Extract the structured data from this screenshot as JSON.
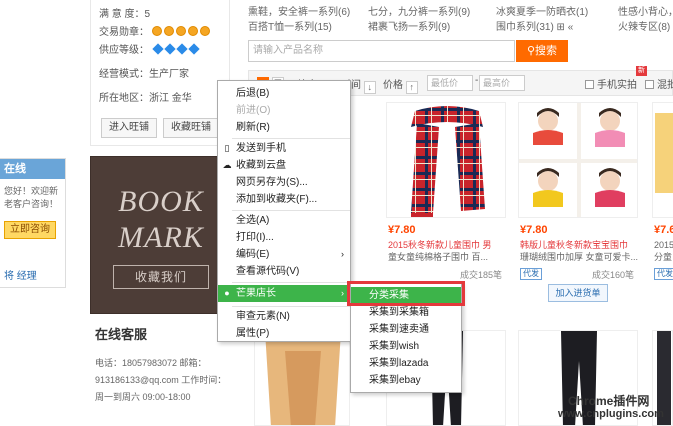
{
  "shop_info": {
    "satisfaction": "满 意 度：5",
    "medal_label": "交易勋章：",
    "supply_label": "供应等级：",
    "business_mode": "经营模式：生产厂家",
    "location": "所在地区：浙江 金华",
    "enter_shop": "进入旺铺",
    "favorite_shop": "收藏旺铺"
  },
  "online": {
    "title": "在线",
    "message": "您好！欢迎新老客户咨询！",
    "consult_button": "立即咨询",
    "footer": "将 经理"
  },
  "banner": {
    "line1": "BOOK",
    "line2": "MARK",
    "collect": "收藏我们"
  },
  "service": {
    "title": "在线客服",
    "phone": "电话：18057983072 邮箱：",
    "email": "913186133@qq.com 工作时间：",
    "hours": "周一到周六 09:00-18:00"
  },
  "categories": [
    "熏鞋，安全裤一系列(6)",
    "七分，九分裤一系列(9)",
    "冰爽夏季一防晒衣(1)",
    "性感小背心，背",
    "百搭T恤一系列(15)",
    "裙裹飞扬一系列(9)",
    "围巾系列(31) ⊞ «",
    "火辣专区(8)"
  ],
  "search": {
    "placeholder": "请输入产品名称",
    "button": "搜索"
  },
  "filters": {
    "sort_popular": "综合",
    "time": "时间",
    "price": "价格",
    "price_min": "最低价",
    "price_max": "最高价",
    "mobile": "手机实拍",
    "mixed": "混批",
    "new": "新"
  },
  "products": [
    {
      "price": "¥7.80",
      "title_prefix": "2015秋冬新款儿童围巾 男",
      "title_rest": "童女童纯棉格子围巾 百...",
      "count": "成交185笔"
    },
    {
      "price": "¥7.80",
      "title_prefix": "韩版儿童秋冬新款宝宝围巾",
      "title_rest": "珊瑚绒围巾加厚 女童可爱卡...",
      "count": "成交160笔",
      "badge": "代发",
      "add_cart": "加入进货单"
    },
    {
      "price": "¥7.6",
      "title_prefix": "2015",
      "title_rest": "分童",
      "badge": "代发"
    }
  ],
  "context_menu": {
    "items": [
      {
        "label": "后退(B)",
        "disabled": false
      },
      {
        "label": "前进(O)",
        "disabled": true
      },
      {
        "label": "刷新(R)",
        "disabled": false
      },
      {
        "label": "发送到手机",
        "disabled": false
      },
      {
        "label": "收藏到云盘",
        "disabled": false
      },
      {
        "label": "网页另存为(S)...",
        "disabled": false
      },
      {
        "label": "添加到收藏夹(F)...",
        "disabled": false
      },
      {
        "label": "全选(A)",
        "disabled": false
      },
      {
        "label": "打印(I)...",
        "disabled": false
      },
      {
        "label": "编码(E)",
        "disabled": false
      },
      {
        "label": "查看源代码(V)",
        "disabled": false
      },
      {
        "label": "芒果店长",
        "disabled": false
      },
      {
        "label": "审查元素(N)",
        "disabled": false
      },
      {
        "label": "属性(P)",
        "disabled": false
      }
    ],
    "submenu": [
      "分类采集",
      "采集到采集箱",
      "采集到速卖通",
      "采集到wish",
      "采集到lazada",
      "采集到ebay"
    ]
  },
  "watermark": {
    "line1": "Chrome插件网",
    "line2": "www.cnplugins.com"
  },
  "colors": {
    "accent_orange": "#ff6a00",
    "menu_highlight": "#3db44a",
    "price_red": "#ff4400",
    "frame_red": "#e4393c"
  }
}
